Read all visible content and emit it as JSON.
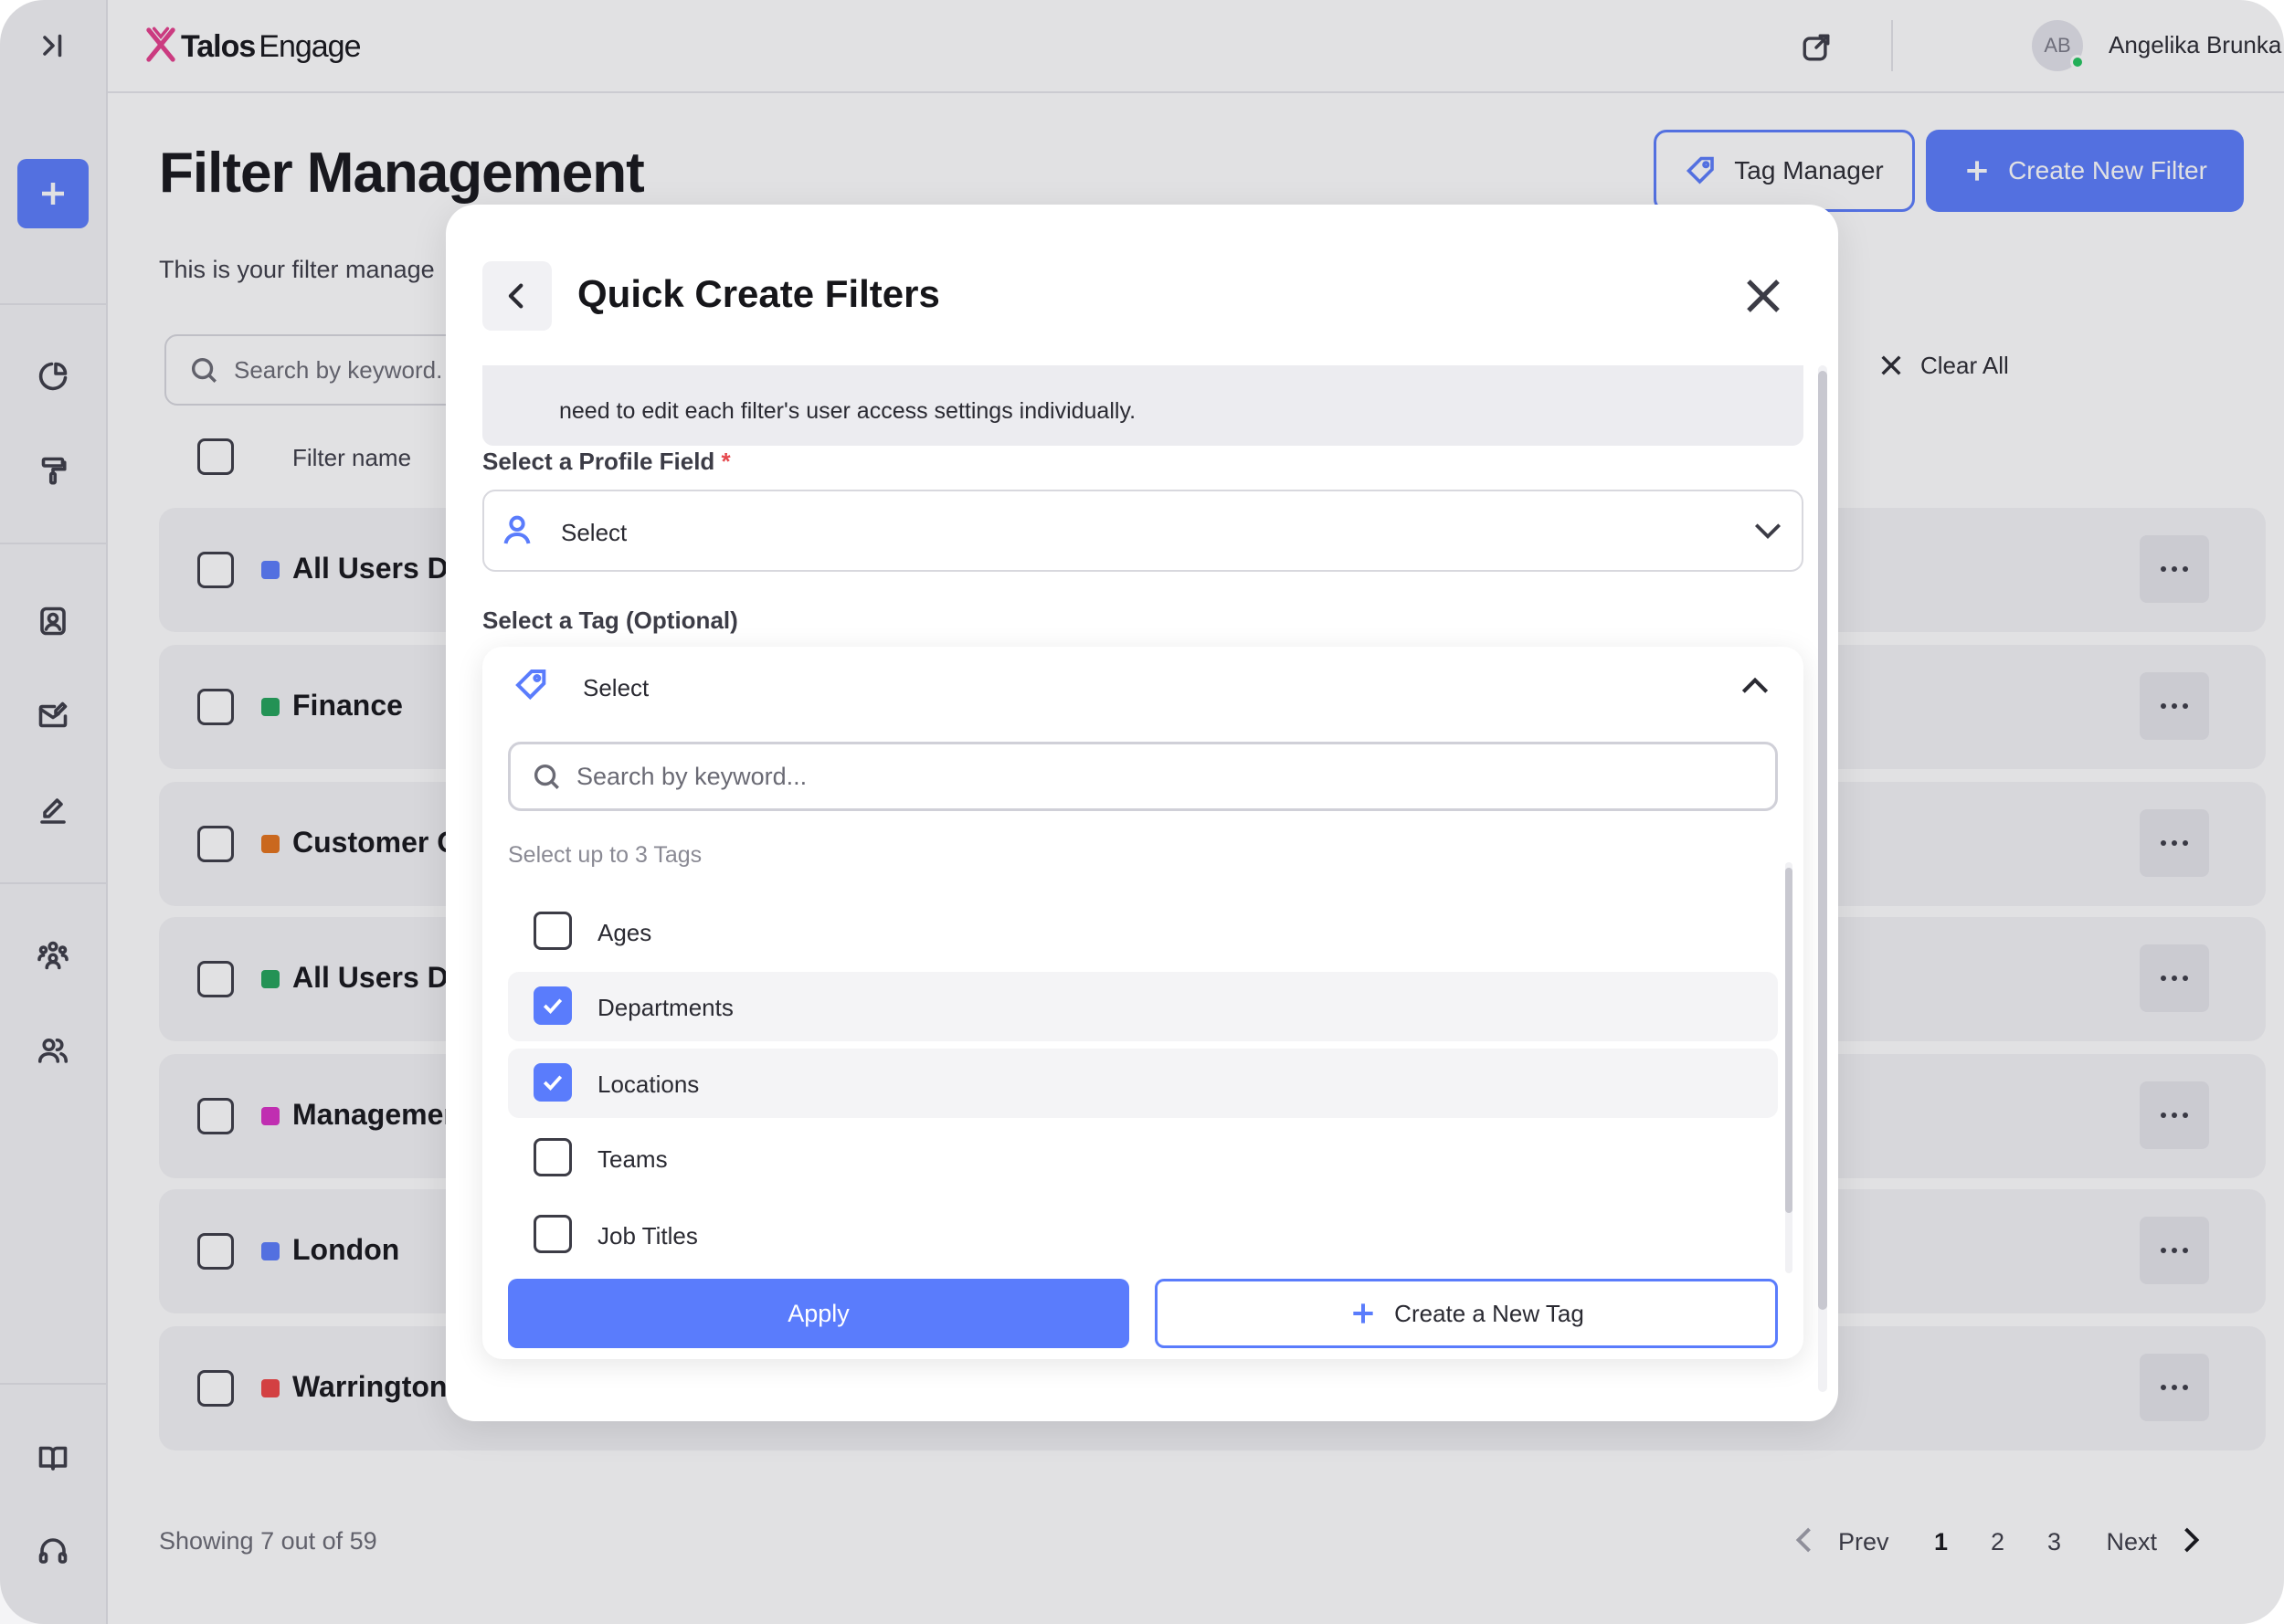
{
  "app": {
    "brand": "Talos",
    "brand_sub": "Engage"
  },
  "user": {
    "initials": "AB",
    "name": "Angelika Brunka",
    "status_color": "#22c55e"
  },
  "sidebar": {
    "icons": [
      "collapse-sidebar-icon",
      "add-icon",
      "pie-chart-icon",
      "paint-roller-icon",
      "contact-icon",
      "mail-edit-icon",
      "pen-icon",
      "groups-icon",
      "users-icon",
      "book-icon",
      "headset-icon"
    ]
  },
  "page": {
    "title": "Filter Management",
    "description": "This is your filter manage",
    "tag_manager_label": "Tag Manager",
    "create_filter_label": "Create New Filter",
    "search_placeholder": "Search by keyword.",
    "clear_all_label": "Clear All",
    "column_filter_name": "Filter name"
  },
  "filters": [
    {
      "name": "All Users Da",
      "color": "#5a7cfc"
    },
    {
      "name": "Finance",
      "color": "#22a35a"
    },
    {
      "name": "Customer O",
      "color": "#e5731a"
    },
    {
      "name": "All Users Da",
      "color": "#22a35a"
    },
    {
      "name": "Managemen",
      "color": "#d92fc5"
    },
    {
      "name": "London",
      "color": "#5a7cfc"
    },
    {
      "name": "Warrington",
      "color": "#ef4444"
    }
  ],
  "footer": {
    "showing": "Showing 7 out of 59",
    "prev": "Prev",
    "next": "Next",
    "pages": [
      "1",
      "2",
      "3"
    ],
    "current_page": "1"
  },
  "modal": {
    "title": "Quick Create Filters",
    "note": "need to edit each filter's user access settings individually.",
    "profile_label": "Select a Profile Field",
    "required_mark": "*",
    "profile_value": "Select",
    "tag_label": "Select a Tag (Optional)",
    "tag_value": "Select",
    "tag_search_placeholder": "Search by keyword...",
    "tag_hint": "Select up to 3 Tags",
    "tags": [
      {
        "label": "Ages",
        "checked": false
      },
      {
        "label": "Departments",
        "checked": true
      },
      {
        "label": "Locations",
        "checked": true
      },
      {
        "label": "Teams",
        "checked": false
      },
      {
        "label": "Job Titles",
        "checked": false
      }
    ],
    "apply_label": "Apply",
    "new_tag_label": "Create a New Tag"
  },
  "colors": {
    "accent": "#5a7cfc",
    "required": "#e5484d"
  }
}
